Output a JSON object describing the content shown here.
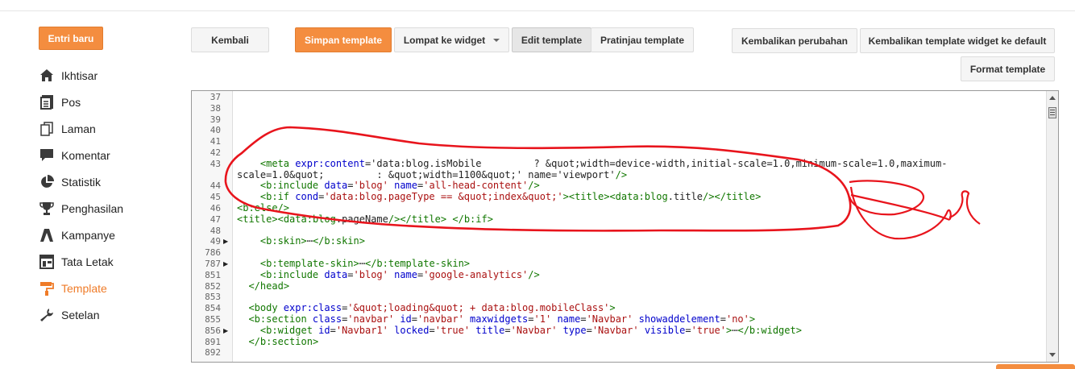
{
  "sidebar": {
    "new_post": "Entri baru",
    "items": [
      {
        "label": "Ikhtisar",
        "icon": "home-icon"
      },
      {
        "label": "Pos",
        "icon": "posts-icon"
      },
      {
        "label": "Laman",
        "icon": "page-icon"
      },
      {
        "label": "Komentar",
        "icon": "comment-icon"
      },
      {
        "label": "Statistik",
        "icon": "pie-chart-icon"
      },
      {
        "label": "Penghasilan",
        "icon": "trophy-icon"
      },
      {
        "label": "Kampanye",
        "icon": "campaign-icon"
      },
      {
        "label": "Tata Letak",
        "icon": "layout-icon"
      },
      {
        "label": "Template",
        "icon": "paint-roller-icon",
        "active": true
      },
      {
        "label": "Setelan",
        "icon": "wrench-icon"
      }
    ]
  },
  "toolbar": {
    "back": "Kembali",
    "save": "Simpan template",
    "jump": "Lompat ke widget",
    "edit": "Edit template",
    "preview": "Pratinjau template",
    "revert": "Kembalikan perubahan",
    "revert_widget": "Kembalikan template widget ke default",
    "format": "Format template"
  },
  "editor": {
    "line_numbers": [
      "37",
      "38",
      "39",
      "40",
      "41",
      "42",
      "43",
      "",
      "44",
      "45",
      "46",
      "47",
      "48",
      "49",
      "786",
      "787",
      "851",
      "852",
      "853",
      "854",
      "855",
      "856",
      "891",
      "892"
    ],
    "folded_lines": [
      "49",
      "787",
      "856"
    ],
    "lines": [
      "",
      "",
      "",
      "",
      "",
      "",
      "    <meta expr:content='data:blog.isMobile         ? &quot;width=device-width,initial-scale=1.0,minimum-scale=1.0,maximum-",
      "scale=1.0&quot;         : &quot;width=1100&quot;' name='viewport'/>",
      "    <b:include data='blog' name='all-head-content'/>",
      "    <b:if cond='data:blog.pageType == &quot;index&quot;'><title><data:blog.title/></title>",
      "<b:else/>",
      "<title><data:blog.pageName/></title> </b:if>",
      "",
      "    <b:skin>⋯</b:skin>",
      "",
      "    <b:template-skin>⋯</b:template-skin>",
      "    <b:include data='blog' name='google-analytics'/>",
      "  </head>",
      "",
      "  <body expr:class='&quot;loading&quot; + data:blog.mobileClass'>",
      "  <b:section class='navbar' id='navbar' maxwidgets='1' name='Navbar' showaddelement='no'>",
      "    <b:widget id='Navbar1' locked='true' title='Navbar' type='Navbar' visible='true'>⋯</b:widget>",
      "  </b:section>",
      ""
    ]
  },
  "colors": {
    "accent": "#f48d3f",
    "active_nav": "#ef7b28",
    "scribble": "#e8141c"
  }
}
